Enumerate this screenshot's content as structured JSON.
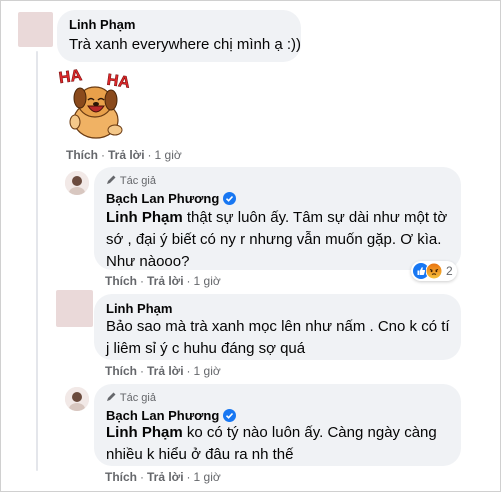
{
  "comments": [
    {
      "author": "Linh Phạm",
      "text": "Trà xanh everywhere chị mình ạ :))",
      "sticker_text": "HA HA",
      "actions": {
        "like": "Thích",
        "reply": "Trả lời",
        "time": "1 giờ"
      }
    },
    {
      "author_tag": "Tác giả",
      "author": "Bạch Lan Phương",
      "mention": "Linh Phạm",
      "lines": [
        " thật sự luôn ấy. Tâm sự dài như một tờ",
        "sớ , đại ý biết có ny r nhưng vẫn muốn gặp. Ơ kìa.",
        "Như nàooo?"
      ],
      "reactions": {
        "icons": [
          "like-icon",
          "angry-icon"
        ],
        "count": "2"
      },
      "actions": {
        "like": "Thích",
        "reply": "Trả lời",
        "time": "1 giờ"
      }
    },
    {
      "author": "Linh Phạm",
      "lines": [
        "Bảo sao mà trà xanh mọc lên như nấm . Cno k có tí",
        "j liêm sỉ ý c huhu đáng sợ quá"
      ],
      "actions": {
        "like": "Thích",
        "reply": "Trả lời",
        "time": "1 giờ"
      }
    },
    {
      "author_tag": "Tác giả",
      "author": "Bạch Lan Phương",
      "mention": "Linh Phạm",
      "lines": [
        " ko có tý nào luôn ấy. Càng ngày càng",
        "nhiều k hiểu ở đâu ra nh thế"
      ],
      "actions": {
        "like": "Thích",
        "reply": "Trả lời",
        "time": "1 giờ"
      }
    }
  ],
  "colors": {
    "bubble": "#f0f2f5",
    "meta": "#65676b",
    "verified": "#1877f2",
    "sticker_red": "#e0282a",
    "sticker_dog": "#e8a04a"
  }
}
